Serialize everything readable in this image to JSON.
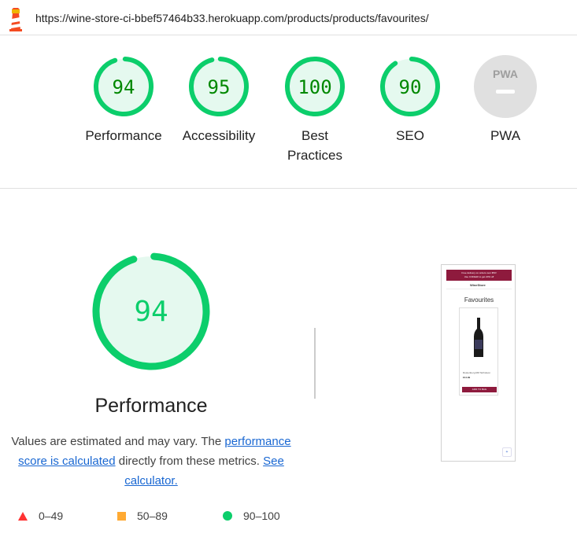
{
  "url": "https://wine-store-ci-bbef57464b33.herokuapp.com/products/products/favourites/",
  "colors": {
    "pass": "#0cce6b",
    "pass_text": "#008800",
    "pass_bg": "#e5f9ef",
    "average": "#ffaa33",
    "fail": "#ff3333",
    "na": "#e0e0e0"
  },
  "categories": [
    {
      "score": "94",
      "label": "Performance",
      "value": 94
    },
    {
      "score": "95",
      "label": "Accessibility",
      "value": 95
    },
    {
      "score": "100",
      "label": "Best Practices",
      "value": 100
    },
    {
      "score": "90",
      "label": "SEO",
      "value": 90
    },
    {
      "score": "PWA",
      "label": "PWA",
      "value": null
    }
  ],
  "performance": {
    "score": "94",
    "value": 94,
    "title": "Performance",
    "desc_prefix": "Values are estimated and may vary. The ",
    "desc_link1": "performance score is calculated",
    "desc_middle": " directly from these metrics. ",
    "desc_link2": "See calculator."
  },
  "screenshot": {
    "banner_line1": "Free delivery on orders over €50!",
    "banner_line2": "Use CODE20 to get 20% off",
    "brand": "WineStore",
    "page_title": "Favourites",
    "product_name": "Rustenberg RM Nicholson",
    "product_price": "€14.99",
    "button_label": "ADD TO BAG",
    "fab_label": "+"
  },
  "legend": [
    {
      "icon": "fail-triangle-icon",
      "range": "0–49"
    },
    {
      "icon": "average-square-icon",
      "range": "50–89"
    },
    {
      "icon": "pass-circle-icon",
      "range": "90–100"
    }
  ]
}
